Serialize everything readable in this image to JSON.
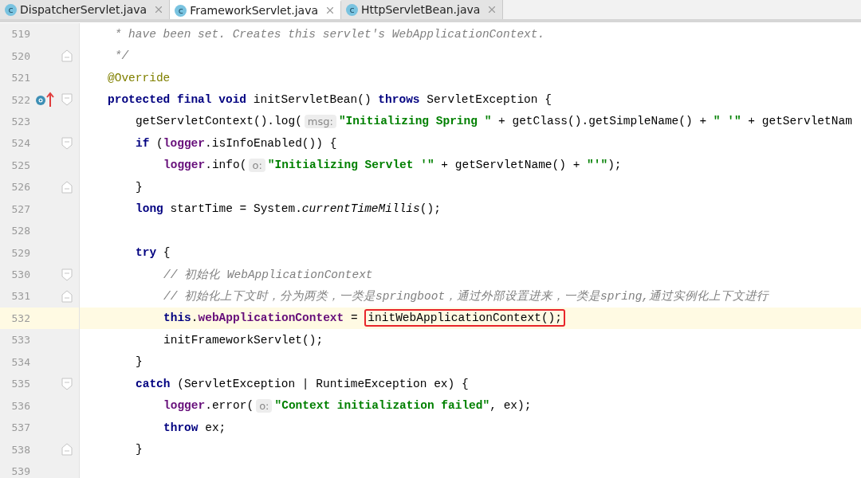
{
  "tabs": [
    {
      "badge": "c",
      "label": "DispatcherServlet.java",
      "selected": false
    },
    {
      "badge": "c",
      "label": "FrameworkServlet.java",
      "selected": true
    },
    {
      "badge": "c",
      "label": "HttpServletBean.java",
      "selected": false
    }
  ],
  "lines": [
    {
      "number": "519",
      "fold_start": false,
      "fold_end": false,
      "overrides": false,
      "current": false,
      "tokens": [
        {
          "kind": "comment",
          "text": " * have been set. Creates this servlet's WebApplicationContext."
        }
      ]
    },
    {
      "number": "520",
      "fold_start": false,
      "fold_end": true,
      "overrides": false,
      "current": false,
      "tokens": [
        {
          "kind": "comment",
          "text": " */"
        }
      ]
    },
    {
      "number": "521",
      "fold_start": false,
      "fold_end": false,
      "overrides": false,
      "current": false,
      "tokens": [
        {
          "kind": "annotation",
          "text": "@Override"
        }
      ]
    },
    {
      "number": "522",
      "fold_start": true,
      "fold_end": false,
      "overrides": true,
      "current": false,
      "tokens": [
        {
          "kind": "keyword",
          "text": "protected final void"
        },
        {
          "kind": "plain",
          "text": " initServletBean() "
        },
        {
          "kind": "keyword",
          "text": "throws"
        },
        {
          "kind": "plain",
          "text": " ServletException {"
        }
      ],
      "children": [
        {
          "number": "523",
          "fold_start": false,
          "fold_end": false,
          "overrides": false,
          "current": false,
          "tokens": [
            {
              "kind": "plain",
              "text": "getServletContext().log("
            },
            {
              "kind": "hint",
              "text": "msg:"
            },
            {
              "kind": "string",
              "text": "\"Initializing Spring \""
            },
            {
              "kind": "plain",
              "text": " + getClass().getSimpleName() + "
            },
            {
              "kind": "string",
              "text": "\" '\""
            },
            {
              "kind": "plain",
              "text": " + getServletNam"
            }
          ]
        },
        {
          "number": "524",
          "fold_start": true,
          "fold_end": false,
          "overrides": false,
          "current": false,
          "tokens": [
            {
              "kind": "keyword",
              "text": "if"
            },
            {
              "kind": "plain",
              "text": " ("
            },
            {
              "kind": "field",
              "text": "logger"
            },
            {
              "kind": "plain",
              "text": ".isInfoEnabled()) {"
            }
          ],
          "children": [
            {
              "number": "525",
              "fold_start": false,
              "fold_end": false,
              "overrides": false,
              "current": false,
              "tokens": [
                {
                  "kind": "field",
                  "text": "logger"
                },
                {
                  "kind": "plain",
                  "text": ".info("
                },
                {
                  "kind": "hint",
                  "text": "o:"
                },
                {
                  "kind": "string",
                  "text": "\"Initializing Servlet '\""
                },
                {
                  "kind": "plain",
                  "text": " + getServletName() + "
                },
                {
                  "kind": "string",
                  "text": "\"'\""
                },
                {
                  "kind": "plain",
                  "text": ");"
                }
              ]
            }
          ]
        },
        {
          "number": "526",
          "fold_start": false,
          "fold_end": true,
          "overrides": false,
          "current": false,
          "tokens": [
            {
              "kind": "plain",
              "text": "}"
            }
          ]
        },
        {
          "number": "527",
          "fold_start": false,
          "fold_end": false,
          "overrides": false,
          "current": false,
          "tokens": [
            {
              "kind": "keyword",
              "text": "long"
            },
            {
              "kind": "plain",
              "text": " startTime = System."
            },
            {
              "kind": "static",
              "text": "currentTimeMillis"
            },
            {
              "kind": "plain",
              "text": "();"
            }
          ]
        },
        {
          "number": "528",
          "fold_start": false,
          "fold_end": false,
          "overrides": false,
          "current": false
        },
        {
          "number": "529",
          "fold_start": false,
          "fold_end": false,
          "overrides": false,
          "current": false,
          "tokens": [
            {
              "kind": "keyword",
              "text": "try"
            },
            {
              "kind": "plain",
              "text": " {"
            }
          ],
          "children": [
            {
              "number": "530",
              "fold_start": true,
              "fold_end": false,
              "overrides": false,
              "current": false,
              "tokens": [
                {
                  "kind": "comment",
                  "text": "// 初始化 WebApplicationContext"
                }
              ]
            },
            {
              "number": "531",
              "fold_start": false,
              "fold_end": true,
              "overrides": false,
              "current": false,
              "tokens": [
                {
                  "kind": "comment",
                  "text": "// 初始化上下文时，分为两类，一类是springboot，通过外部设置进来，一类是spring,通过实例化上下文进行"
                }
              ]
            },
            {
              "number": "532",
              "fold_start": false,
              "fold_end": false,
              "overrides": false,
              "current": true,
              "tokens": [
                {
                  "kind": "keyword",
                  "text": "this"
                },
                {
                  "kind": "plain",
                  "text": "."
                },
                {
                  "kind": "field",
                  "text": "webApplicationContext"
                },
                {
                  "kind": "plain",
                  "text": " = "
                },
                {
                  "kind": "boxed",
                  "text": "initWebApplicationContext();"
                }
              ]
            },
            {
              "number": "533",
              "fold_start": false,
              "fold_end": false,
              "overrides": false,
              "current": false,
              "tokens": [
                {
                  "kind": "plain",
                  "text": "initFrameworkServlet();"
                }
              ]
            }
          ]
        },
        {
          "number": "534",
          "fold_start": false,
          "fold_end": false,
          "overrides": false,
          "current": false,
          "tokens": [
            {
              "kind": "plain",
              "text": "}"
            }
          ]
        },
        {
          "number": "535",
          "fold_start": true,
          "fold_end": false,
          "overrides": false,
          "current": false,
          "tokens": [
            {
              "kind": "keyword",
              "text": "catch"
            },
            {
              "kind": "plain",
              "text": " (ServletException | RuntimeException ex) {"
            }
          ],
          "children": [
            {
              "number": "536",
              "fold_start": false,
              "fold_end": false,
              "overrides": false,
              "current": false,
              "tokens": [
                {
                  "kind": "field",
                  "text": "logger"
                },
                {
                  "kind": "plain",
                  "text": ".error("
                },
                {
                  "kind": "hint",
                  "text": "o:"
                },
                {
                  "kind": "string",
                  "text": "\"Context initialization failed\""
                },
                {
                  "kind": "plain",
                  "text": ", ex);"
                }
              ]
            },
            {
              "number": "537",
              "fold_start": false,
              "fold_end": false,
              "overrides": false,
              "current": false,
              "tokens": [
                {
                  "kind": "keyword",
                  "text": "throw"
                },
                {
                  "kind": "plain",
                  "text": " ex;"
                }
              ]
            }
          ]
        },
        {
          "number": "538",
          "fold_start": false,
          "fold_end": true,
          "overrides": false,
          "current": false,
          "tokens": [
            {
              "kind": "plain",
              "text": "}"
            }
          ]
        }
      ]
    },
    {
      "number": "539",
      "fold_start": false,
      "fold_end": false,
      "overrides": false,
      "current": false
    }
  ]
}
